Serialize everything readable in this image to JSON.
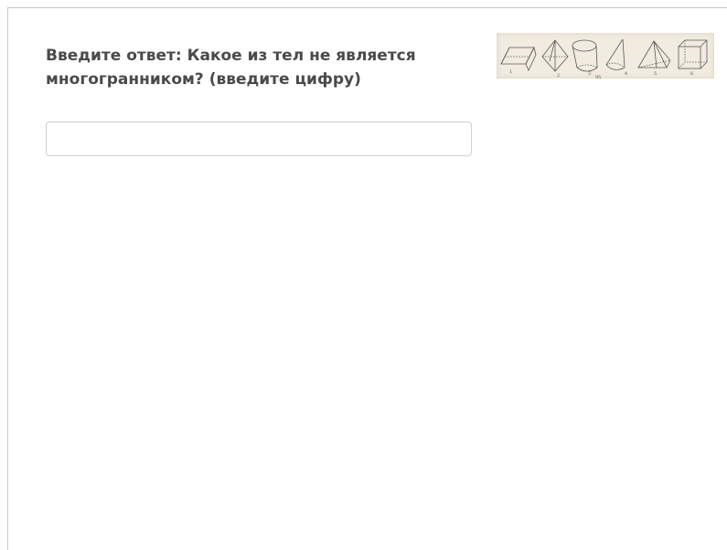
{
  "question": {
    "text": "Введите ответ: Какое из тел не является многогранником? (введите цифру)"
  },
  "answer_field": {
    "value": "",
    "placeholder": ""
  },
  "figure": {
    "shapes": [
      {
        "number": "1",
        "shape": "prism-icon"
      },
      {
        "number": "2",
        "shape": "pyramid-icon"
      },
      {
        "number": "3",
        "shape": "cylinder-icon"
      },
      {
        "number": "4",
        "shape": "cone-icon"
      },
      {
        "number": "5",
        "shape": "pyramid-icon"
      },
      {
        "number": "6",
        "shape": "cube-icon"
      }
    ],
    "page_label": "95"
  }
}
